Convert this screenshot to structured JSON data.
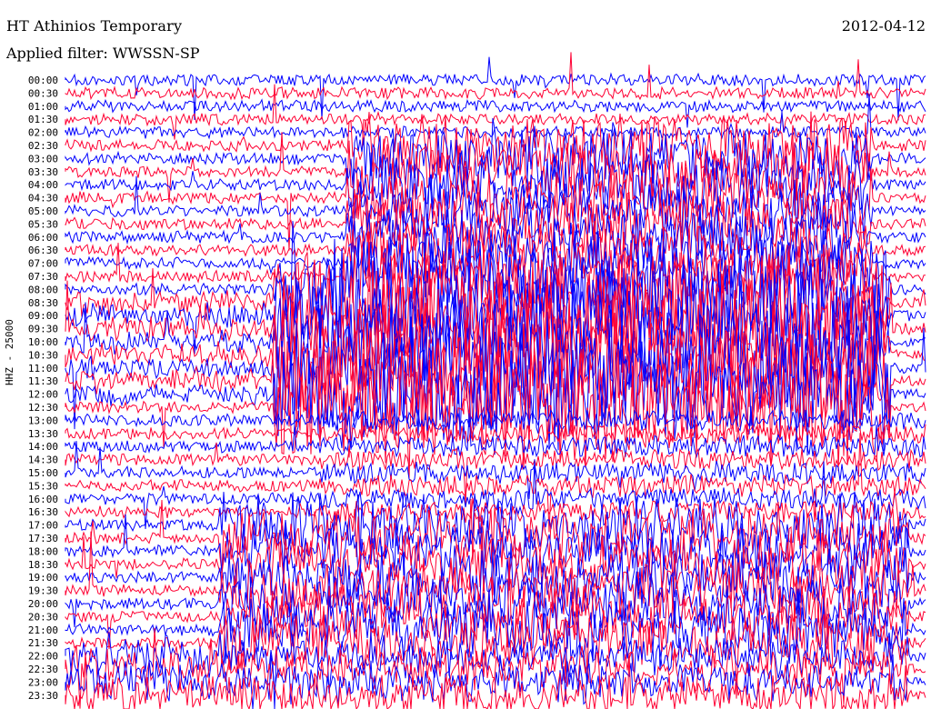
{
  "header": {
    "station": "HT Athinios Temporary",
    "filter": "Applied filter: WWSSN-SP",
    "date": "2012-04-12"
  },
  "chart_data": {
    "type": "line",
    "title": "HT Athinios Temporary",
    "subtitle": "Applied filter: WWSSN-SP",
    "ylabel": "HHZ - 25000",
    "row_labels": [
      "00:00",
      "00:30",
      "01:00",
      "01:30",
      "02:00",
      "02:30",
      "03:00",
      "03:30",
      "04:00",
      "04:30",
      "05:00",
      "05:30",
      "06:00",
      "06:30",
      "07:00",
      "07:30",
      "08:00",
      "08:30",
      "09:00",
      "09:30",
      "10:00",
      "10:30",
      "11:00",
      "11:30",
      "12:00",
      "12:30",
      "13:00",
      "13:30",
      "14:00",
      "14:30",
      "15:00",
      "15:30",
      "16:00",
      "16:30",
      "17:00",
      "17:30",
      "18:00",
      "18:30",
      "19:00",
      "19:30",
      "20:00",
      "20:30",
      "21:00",
      "21:30",
      "22:00",
      "22:30",
      "23:00",
      "23:30"
    ],
    "series_colors": [
      "#0000ff",
      "#ff0033"
    ],
    "line_minutes": 30,
    "grid": false,
    "legend": "none"
  }
}
